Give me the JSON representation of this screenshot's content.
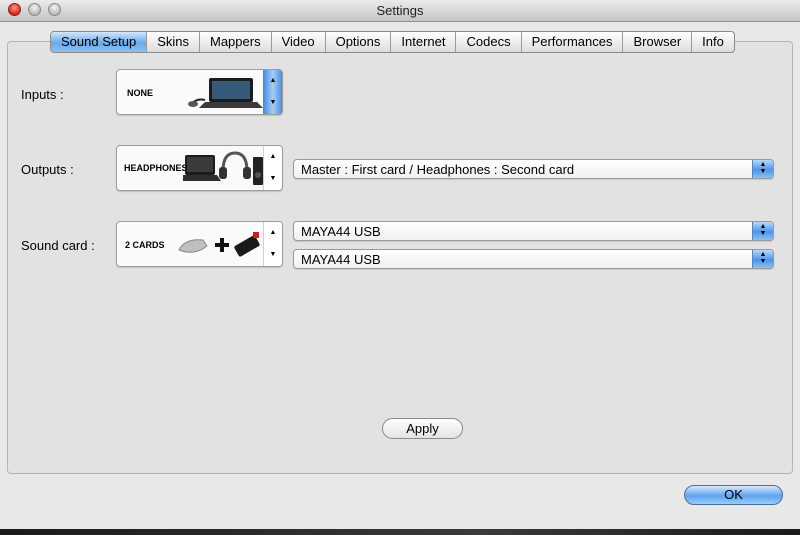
{
  "window": {
    "title": "Settings"
  },
  "tabs": [
    {
      "label": "Sound Setup",
      "active": true
    },
    {
      "label": "Skins"
    },
    {
      "label": "Mappers"
    },
    {
      "label": "Video"
    },
    {
      "label": "Options"
    },
    {
      "label": "Internet"
    },
    {
      "label": "Codecs"
    },
    {
      "label": "Performances"
    },
    {
      "label": "Browser"
    },
    {
      "label": "Info"
    }
  ],
  "inputs": {
    "label": "Inputs :",
    "selector_text": "NONE"
  },
  "outputs": {
    "label": "Outputs :",
    "selector_text": "HEADPHONES",
    "mode_value": "Master : First card / Headphones : Second card"
  },
  "sound_card": {
    "label": "Sound card :",
    "selector_text": "2 CARDS",
    "card1_value": "MAYA44 USB",
    "card2_value": "MAYA44 USB"
  },
  "buttons": {
    "apply": "Apply",
    "ok": "OK"
  },
  "stepper": {
    "up": "▲",
    "down": "▼"
  }
}
